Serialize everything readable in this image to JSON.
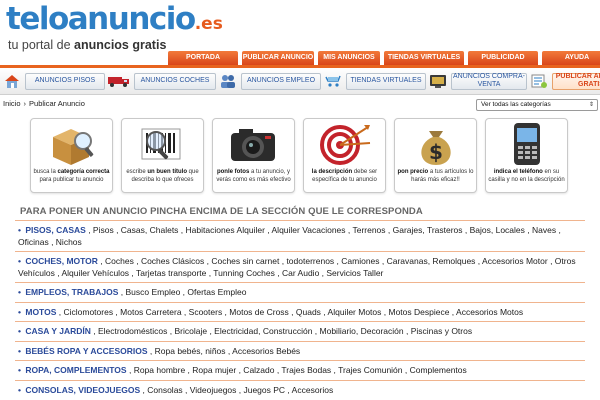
{
  "logo": {
    "main": "teloanuncio",
    "tld": ".es",
    "tagline_pre": "tu portal de ",
    "tagline_bold": "anuncios gratis"
  },
  "top_tabs": [
    "PORTADA",
    "PUBLICAR ANUNCIO",
    "MIS ANUNCIOS",
    "TIENDAS VIRTUALES",
    "PUBLICIDAD",
    "AYUDA"
  ],
  "category_nav": [
    {
      "label": "ANUNCIOS PISOS",
      "icon": "house-icon"
    },
    {
      "label": "ANUNCIOS COCHES",
      "icon": "truck-icon"
    },
    {
      "label": "ANUNCIOS EMPLEO",
      "icon": "people-icon"
    },
    {
      "label": "TIENDAS VIRTUALES",
      "icon": "shop-icon"
    },
    {
      "label": "ANUNCIOS COMPRA-VENTA",
      "icon": "tv-icon"
    },
    {
      "label": "PUBLICAR ANUNCIO GRATIS",
      "icon": "publish-icon"
    }
  ],
  "breadcrumb": [
    "Inicio",
    "Publicar Anuncio"
  ],
  "category_select": {
    "selected": "Ver todas las categorías"
  },
  "cards": [
    {
      "pre": "busca la ",
      "bold": "categoría correcta",
      "post": " para publicar tu anuncio",
      "icon": "box-magnifier-icon"
    },
    {
      "pre": "escribe ",
      "bold": "un buen título",
      "post": " que describa lo que ofreces",
      "icon": "barcode-magnifier-icon"
    },
    {
      "pre": "",
      "bold": "ponle fotos",
      "post": " a tu anuncio, y verás como es más efectivo",
      "icon": "camera-icon"
    },
    {
      "pre": "",
      "bold": "la descripción",
      "post": " debe ser específica de tu anuncio",
      "icon": "target-icon"
    },
    {
      "pre": "",
      "bold": "pon precio",
      "post": " a tus artículos lo harás más eficaz!!",
      "icon": "money-bag-icon"
    },
    {
      "pre": "",
      "bold": "indica el teléfono",
      "post": " en su casilla y no en la descripción",
      "icon": "mobile-phone-icon"
    }
  ],
  "instruction": "PARA PONER UN ANUNCIO PINCHA ENCIMA DE LA SECCIÓN QUE LE CORRESPONDA",
  "categories": [
    {
      "name": "PISOS, CASAS",
      "subs": ", Pisos , Casas, Chalets , Habitaciones Alquiler , Alquiler Vacaciones , Terrenos , Garajes, Trasteros , Bajos, Locales , Naves , Oficinas , Nichos"
    },
    {
      "name": "COCHES, MOTOR",
      "subs": ", Coches , Coches Clásicos , Coches sin carnet , todoterrenos , Camiones , Caravanas, Remolques , Accesorios Motor , Otros Vehículos , Alquiler Vehículos , Tarjetas transporte , Tunning Coches , Car Audio , Servicios Taller"
    },
    {
      "name": "EMPLEOS, TRABAJOS",
      "subs": ", Busco Empleo , Ofertas Empleo"
    },
    {
      "name": "MOTOS",
      "subs": ", Ciclomotores , Motos Carretera , Scooters , Motos de Cross , Quads , Alquiler Motos , Motos Despiece , Accesorios Motos"
    },
    {
      "name": "CASA Y JARDÍN",
      "subs": ", Electrodomésticos , Bricolaje , Electricidad, Construcción , Mobiliario, Decoración , Piscinas y Otros"
    },
    {
      "name": "BEBÉS ROPA Y ACCESORIOS",
      "subs": ", Ropa bebés, niños , Accesorios Bebés"
    },
    {
      "name": "ROPA, COMPLEMENTOS",
      "subs": ", Ropa hombre , Ropa mujer , Calzado , Trajes Bodas , Trajes Comunión , Complementos"
    },
    {
      "name": "CONSOLAS, VIDEOJUEGOS",
      "subs": ", Consolas , Videojuegos , Juegos PC , Accesorios"
    }
  ],
  "colors": {
    "brand_blue": "#2e7fc4",
    "brand_orange": "#e65b1e",
    "link_blue": "#2a4a9a"
  }
}
